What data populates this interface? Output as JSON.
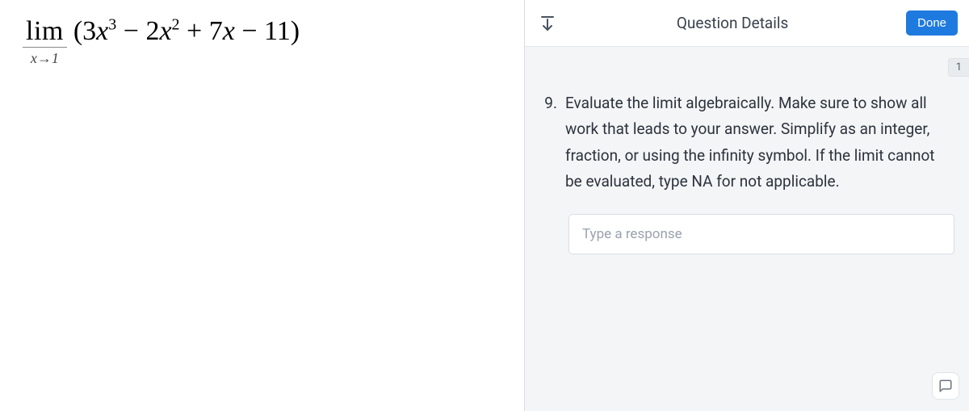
{
  "left": {
    "lim_word": "lim",
    "lim_sub": "x→1",
    "poly_html": "(3x³ − 2x² + 7x − 11)"
  },
  "header": {
    "title": "Question Details",
    "done_label": "Done"
  },
  "question": {
    "points": "1",
    "number": "9.",
    "prompt": "Evaluate the limit algebraically. Make sure to show all work that leads to your answer. Simplify as an integer, fraction, or using the infinity symbol. If the limit cannot be evaluated, type NA for not applicable."
  },
  "response": {
    "placeholder": "Type a response"
  }
}
